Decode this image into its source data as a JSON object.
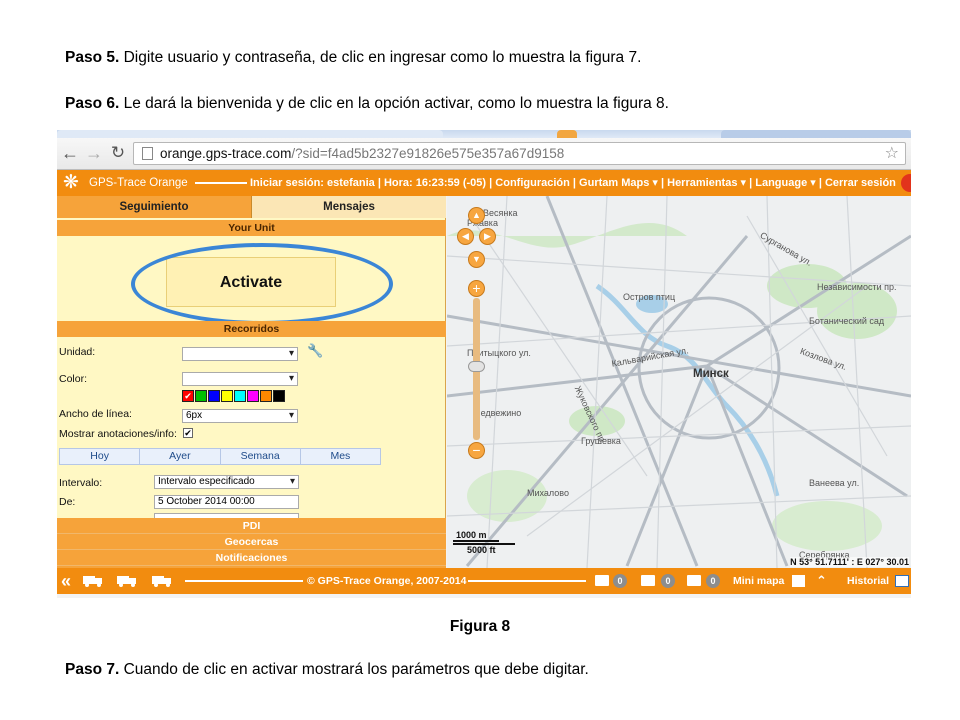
{
  "doc": {
    "p5": {
      "label": "Paso 5.",
      "text": " Digite usuario y contraseña, de clic en ingresar como lo muestra la figura 7."
    },
    "p6": {
      "label": "Paso 6.",
      "text": " Le dará la bienvenida y de clic en la opción activar, como lo muestra la figura 8."
    },
    "caption": "Figura 8",
    "p7": {
      "label": "Paso 7.",
      "text": " Cuando de clic en activar mostrará los parámetros que debe digitar."
    }
  },
  "browser": {
    "url_host": "orange.gps-trace.com",
    "url_path": "/?sid=f4ad5b2327e91826e575e357a67d9158"
  },
  "app": {
    "brand": "GPS-Trace Orange",
    "userbar": {
      "login_label": "Iniciar sesión:",
      "user": "estefania",
      "sep": "|",
      "hora_label": "Hora:",
      "hora": "16:23:59 (-05)",
      "configuracion": "Configuración",
      "gurtam_maps": "Gurtam Maps",
      "herramientas": "Herramientas",
      "language": "Language",
      "cerrar": "Cerrar sesión"
    },
    "tabs": {
      "seguimiento": "Seguimiento",
      "mensajes": "Mensajes"
    },
    "your_unit": "Your Unit",
    "activate": "Activate",
    "recorridos": "Recorridos",
    "form": {
      "unidad": "Unidad:",
      "color": "Color:",
      "ancho": "Ancho de línea:",
      "ancho_value": "6px",
      "mostrar": "Mostrar anotaciones/info:",
      "mostrar_checked": "✔",
      "intervalo": "Intervalo:",
      "intervalo_value": "Intervalo especificado",
      "de": "De:",
      "de_value": "5 October 2014 00:00"
    },
    "swatch_colors": [
      "#ff0000",
      "#00c000",
      "#0000ff",
      "#ffff00",
      "#00ffff",
      "#ff00ff",
      "#ff8800",
      "#000000"
    ],
    "period_tabs": [
      "Hoy",
      "Ayer",
      "Semana",
      "Mes"
    ],
    "accordion": [
      "PDI",
      "Geocercas",
      "Notificaciones"
    ],
    "map": {
      "city": "Минск",
      "labels": {
        "l1": "Весянка",
        "l2": "Ржавка",
        "l3": "Остров птиц",
        "l4": "Сурганова ул.",
        "l5": "Независимости пр.",
        "l6": "Ботанический сад",
        "l7": "Кальварийская ул.",
        "l8": "Козлова ул.",
        "l9": "Медвежино",
        "l10": "Грушевка",
        "l11": "Михалово",
        "l12": "Ванеева ул.",
        "l13": "Серебрянка",
        "l14": "Притыцкого ул.",
        "l15": "Жуковского пр."
      },
      "scale_km": "1000 m",
      "scale_ft": "5000 ft",
      "coords": "N 53° 51.7111' : E 027° 30.01"
    },
    "bottom": {
      "copyright": "© GPS-Trace Orange, 2007-2014",
      "counters": [
        "0",
        "0",
        "0"
      ],
      "minimapa": "Mini mapa",
      "historial": "Historial"
    }
  }
}
